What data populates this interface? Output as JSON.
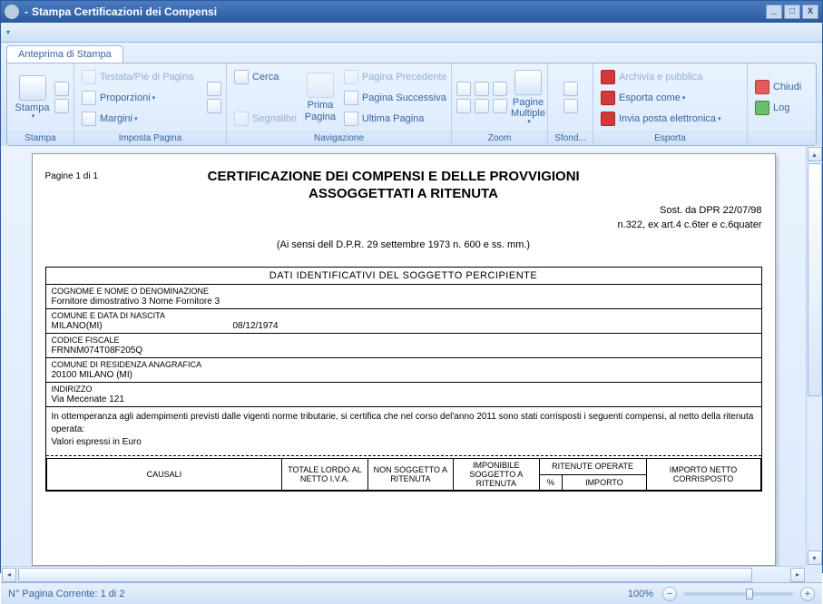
{
  "window": {
    "title": "Stampa Certificazioni dei Compensi",
    "sep": "-"
  },
  "tab": {
    "label": "Anteprima di Stampa"
  },
  "ribbon": {
    "stampa": {
      "title": "Stampa",
      "print": "Stampa"
    },
    "imposta": {
      "title": "Imposta Pagina",
      "testata": "Testata/Piè di Pagina",
      "proporzioni": "Proporzioni",
      "margini": "Margini"
    },
    "nav": {
      "title": "Navigazione",
      "cerca": "Cerca",
      "segnalibri": "Segnalibri",
      "prima": "Prima Pagina",
      "precedente": "Pagina Precedente",
      "successiva": "Pagina Successiva",
      "ultima": "Ultima Pagina"
    },
    "zoom": {
      "title": "Zoom",
      "multiple": "Pagine Multiple"
    },
    "sfondo": {
      "title": "Sfond..."
    },
    "esporta": {
      "title": "Esporta",
      "archivia": "Archivia e pubblica",
      "esporta_come": "Esporta come",
      "invia": "Invia posta elettronica"
    },
    "chiudi": "Chiudi",
    "log": "Log"
  },
  "doc": {
    "page_of": "Pagine 1 di 1",
    "title1": "CERTIFICAZIONE DEI COMPENSI E DELLE PROVVIGIONI",
    "title2": "ASSOGGETTATI A RITENUTA",
    "sost": "Sost. da DPR 22/07/98",
    "art": "n.322, ex art.4 c.6ter e c.6quater",
    "sensi": "(Ai sensi dell D.P.R. 29 settembre 1973 n. 600 e ss. mm.)",
    "sec_header": "DATI IDENTIFICATIVI DEL SOGGETTO PERCIPIENTE",
    "lbl_cognome": "COGNOME E NOME O DENOMINAZIONE",
    "val_cognome": "Fornitore dimostrativo 3 Nome Fornitore 3",
    "lbl_comdata": "COMUNE E DATA DI NASCITA",
    "val_comune": "MILANO(MI)",
    "val_data": "08/12/1974",
    "lbl_cf": "CODICE FISCALE",
    "val_cf": "FRNNM074T08F205Q",
    "lbl_res": "COMUNE DI RESIDENZA ANAGRAFICA",
    "val_res": "20100 MILANO (MI)",
    "lbl_ind": "INDIRIZZO",
    "val_ind": "Via Mecenate 121",
    "body1": "In ottemperanza agli adempimenti previsti dalle vigenti norme tributarie, si certifica che nel corso del'anno    2011  sono stati corrisposti i seguenti compensi, al netto della ritenuta operata:",
    "body2": "Valori espressi in Euro",
    "tbl": {
      "causali": "CAUSALI",
      "totale": "TOTALE LORDO AL NETTO I.V.A.",
      "nonsogg": "NON SOGGETTO A RITENUTA",
      "imponibile": "IMPONIBILE SOGGETTO A RITENUTA",
      "ritenute": "RITENUTE OPERATE",
      "perc": "%",
      "importo": "IMPORTO",
      "netto": "IMPORTO NETTO CORRISPOSTO"
    }
  },
  "status": {
    "page": "N° Pagina Corrente: 1 di 2",
    "zoom": "100%"
  }
}
